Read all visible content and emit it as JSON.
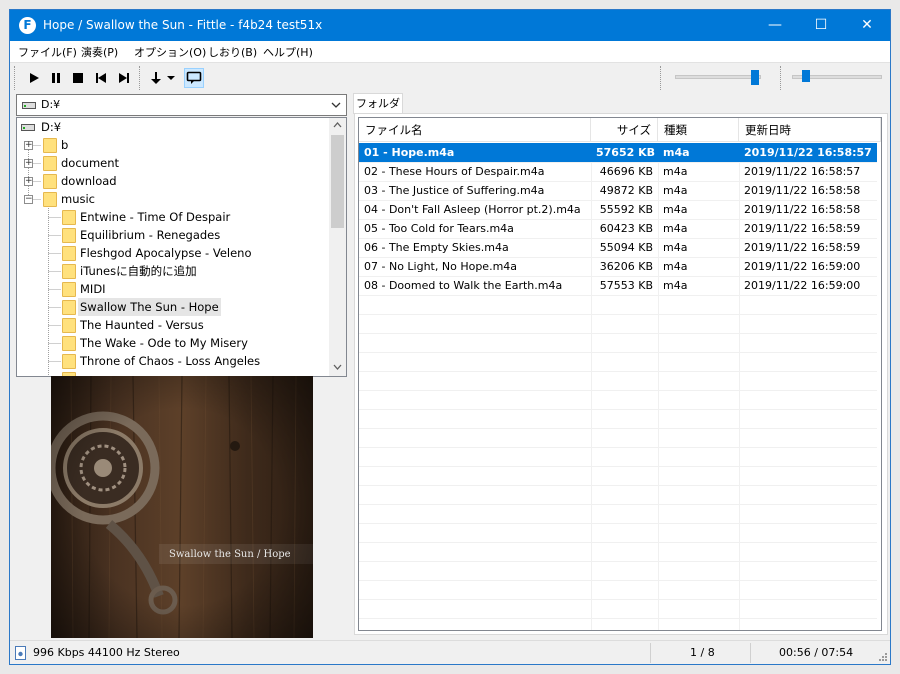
{
  "window": {
    "title": "Hope / Swallow the Sun - Fittle - f4b24 test51x",
    "app_icon_letter": "F",
    "minimize": "—",
    "maximize": "☐",
    "close": "✕"
  },
  "menu": [
    "ファイル(F)",
    "演奏(P)",
    "オプション(O)",
    "しおり(B)",
    "ヘルプ(H)"
  ],
  "toolbar": {
    "icons": [
      "play-icon",
      "pause-icon",
      "stop-icon",
      "prev-icon",
      "next-icon",
      "down-arrow-icon",
      "repeat-icon"
    ],
    "volume_level": 0.97,
    "seek_level": 0.12
  },
  "drive_combo": {
    "value": "D:¥"
  },
  "tree": {
    "root": "D:¥",
    "folders": [
      {
        "label": "b",
        "expander": "+"
      },
      {
        "label": "document",
        "expander": "+"
      },
      {
        "label": "download",
        "expander": "+"
      },
      {
        "label": "music",
        "expander": "−"
      }
    ],
    "music_children": [
      "Entwine - Time Of Despair",
      "Equilibrium - Renegades",
      "Fleshgod Apocalypse - Veleno",
      "iTunesに自動的に追加",
      "MIDI",
      "Swallow The Sun - Hope",
      "The Haunted - Versus",
      "The Wake - Ode to My Misery",
      "Throne of Chaos - Loss Angeles"
    ],
    "selected_child": 5
  },
  "cover": {
    "overlay_text": "Swallow the Sun / Hope"
  },
  "tab": {
    "label": "フォルダ"
  },
  "list": {
    "columns": [
      "ファイル名",
      "サイズ",
      "種類",
      "更新日時"
    ],
    "rows": [
      {
        "name": "01 - Hope.m4a",
        "size": "57652 KB",
        "type": "m4a",
        "date": "2019/11/22 16:58:57"
      },
      {
        "name": "02 - These Hours of Despair.m4a",
        "size": "46696 KB",
        "type": "m4a",
        "date": "2019/11/22 16:58:57"
      },
      {
        "name": "03 - The Justice of Suffering.m4a",
        "size": "49872 KB",
        "type": "m4a",
        "date": "2019/11/22 16:58:58"
      },
      {
        "name": "04 - Don't Fall Asleep (Horror pt.2).m4a",
        "size": "55592 KB",
        "type": "m4a",
        "date": "2019/11/22 16:58:58"
      },
      {
        "name": "05 - Too Cold for Tears.m4a",
        "size": "60423 KB",
        "type": "m4a",
        "date": "2019/11/22 16:58:59"
      },
      {
        "name": "06 - The Empty Skies.m4a",
        "size": "55094 KB",
        "type": "m4a",
        "date": "2019/11/22 16:58:59"
      },
      {
        "name": "07 - No Light, No Hope.m4a",
        "size": "36206 KB",
        "type": "m4a",
        "date": "2019/11/22 16:59:00"
      },
      {
        "name": "08 - Doomed to Walk the Earth.m4a",
        "size": "57553 KB",
        "type": "m4a",
        "date": "2019/11/22 16:59:00"
      }
    ],
    "selected_index": 0
  },
  "status": {
    "audio_info": "996 Kbps  44100 Hz  Stereo",
    "track_pos": "1 / 8",
    "time": "00:56 / 07:54"
  },
  "colors": {
    "titlebar": "#0078d7",
    "selection": "#0078d7",
    "folder": "#ffe17d"
  }
}
